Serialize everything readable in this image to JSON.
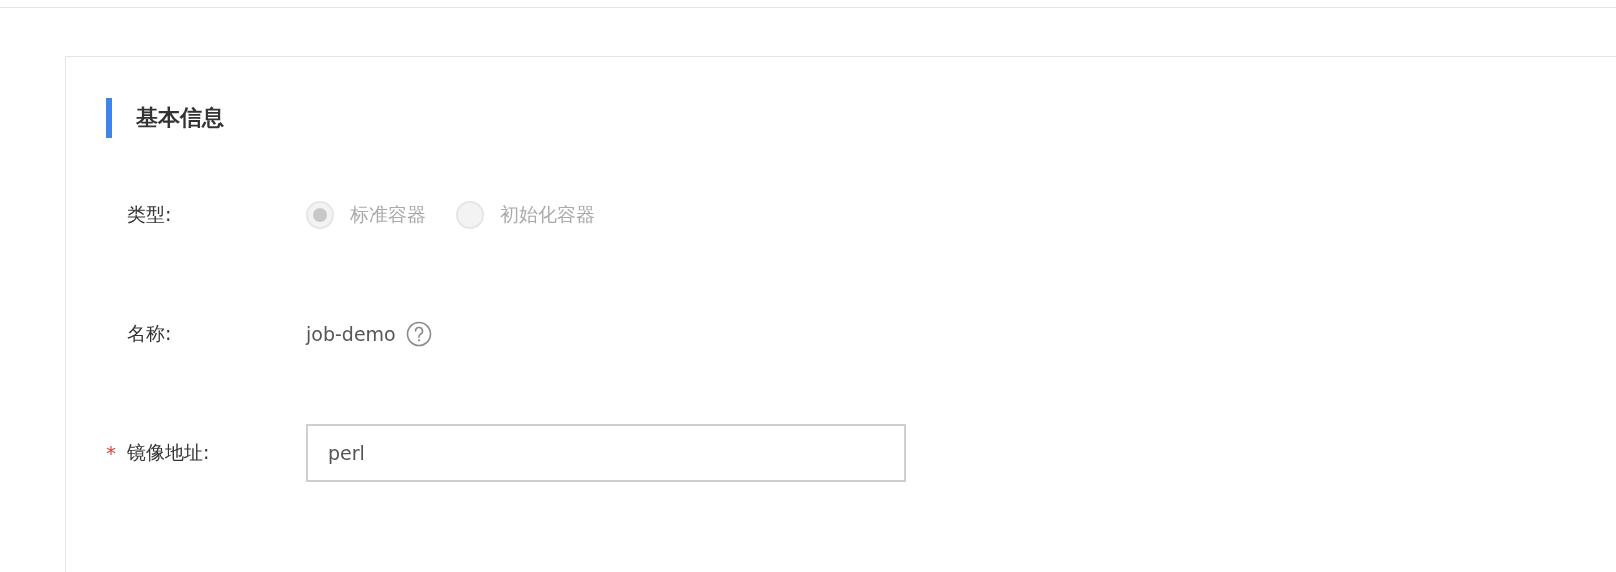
{
  "section": {
    "title": "基本信息"
  },
  "fields": [
    {
      "kind": "radio",
      "label": "类型:",
      "options": [
        {
          "label": "标准容器",
          "selected": true,
          "disabled": true
        },
        {
          "label": "初始化容器",
          "selected": false,
          "disabled": true
        }
      ]
    },
    {
      "kind": "text",
      "label": "名称:",
      "value": "job-demo",
      "help": true
    },
    {
      "kind": "input",
      "label": "镜像地址:",
      "required_mark": "*",
      "value": "perl"
    }
  ]
}
